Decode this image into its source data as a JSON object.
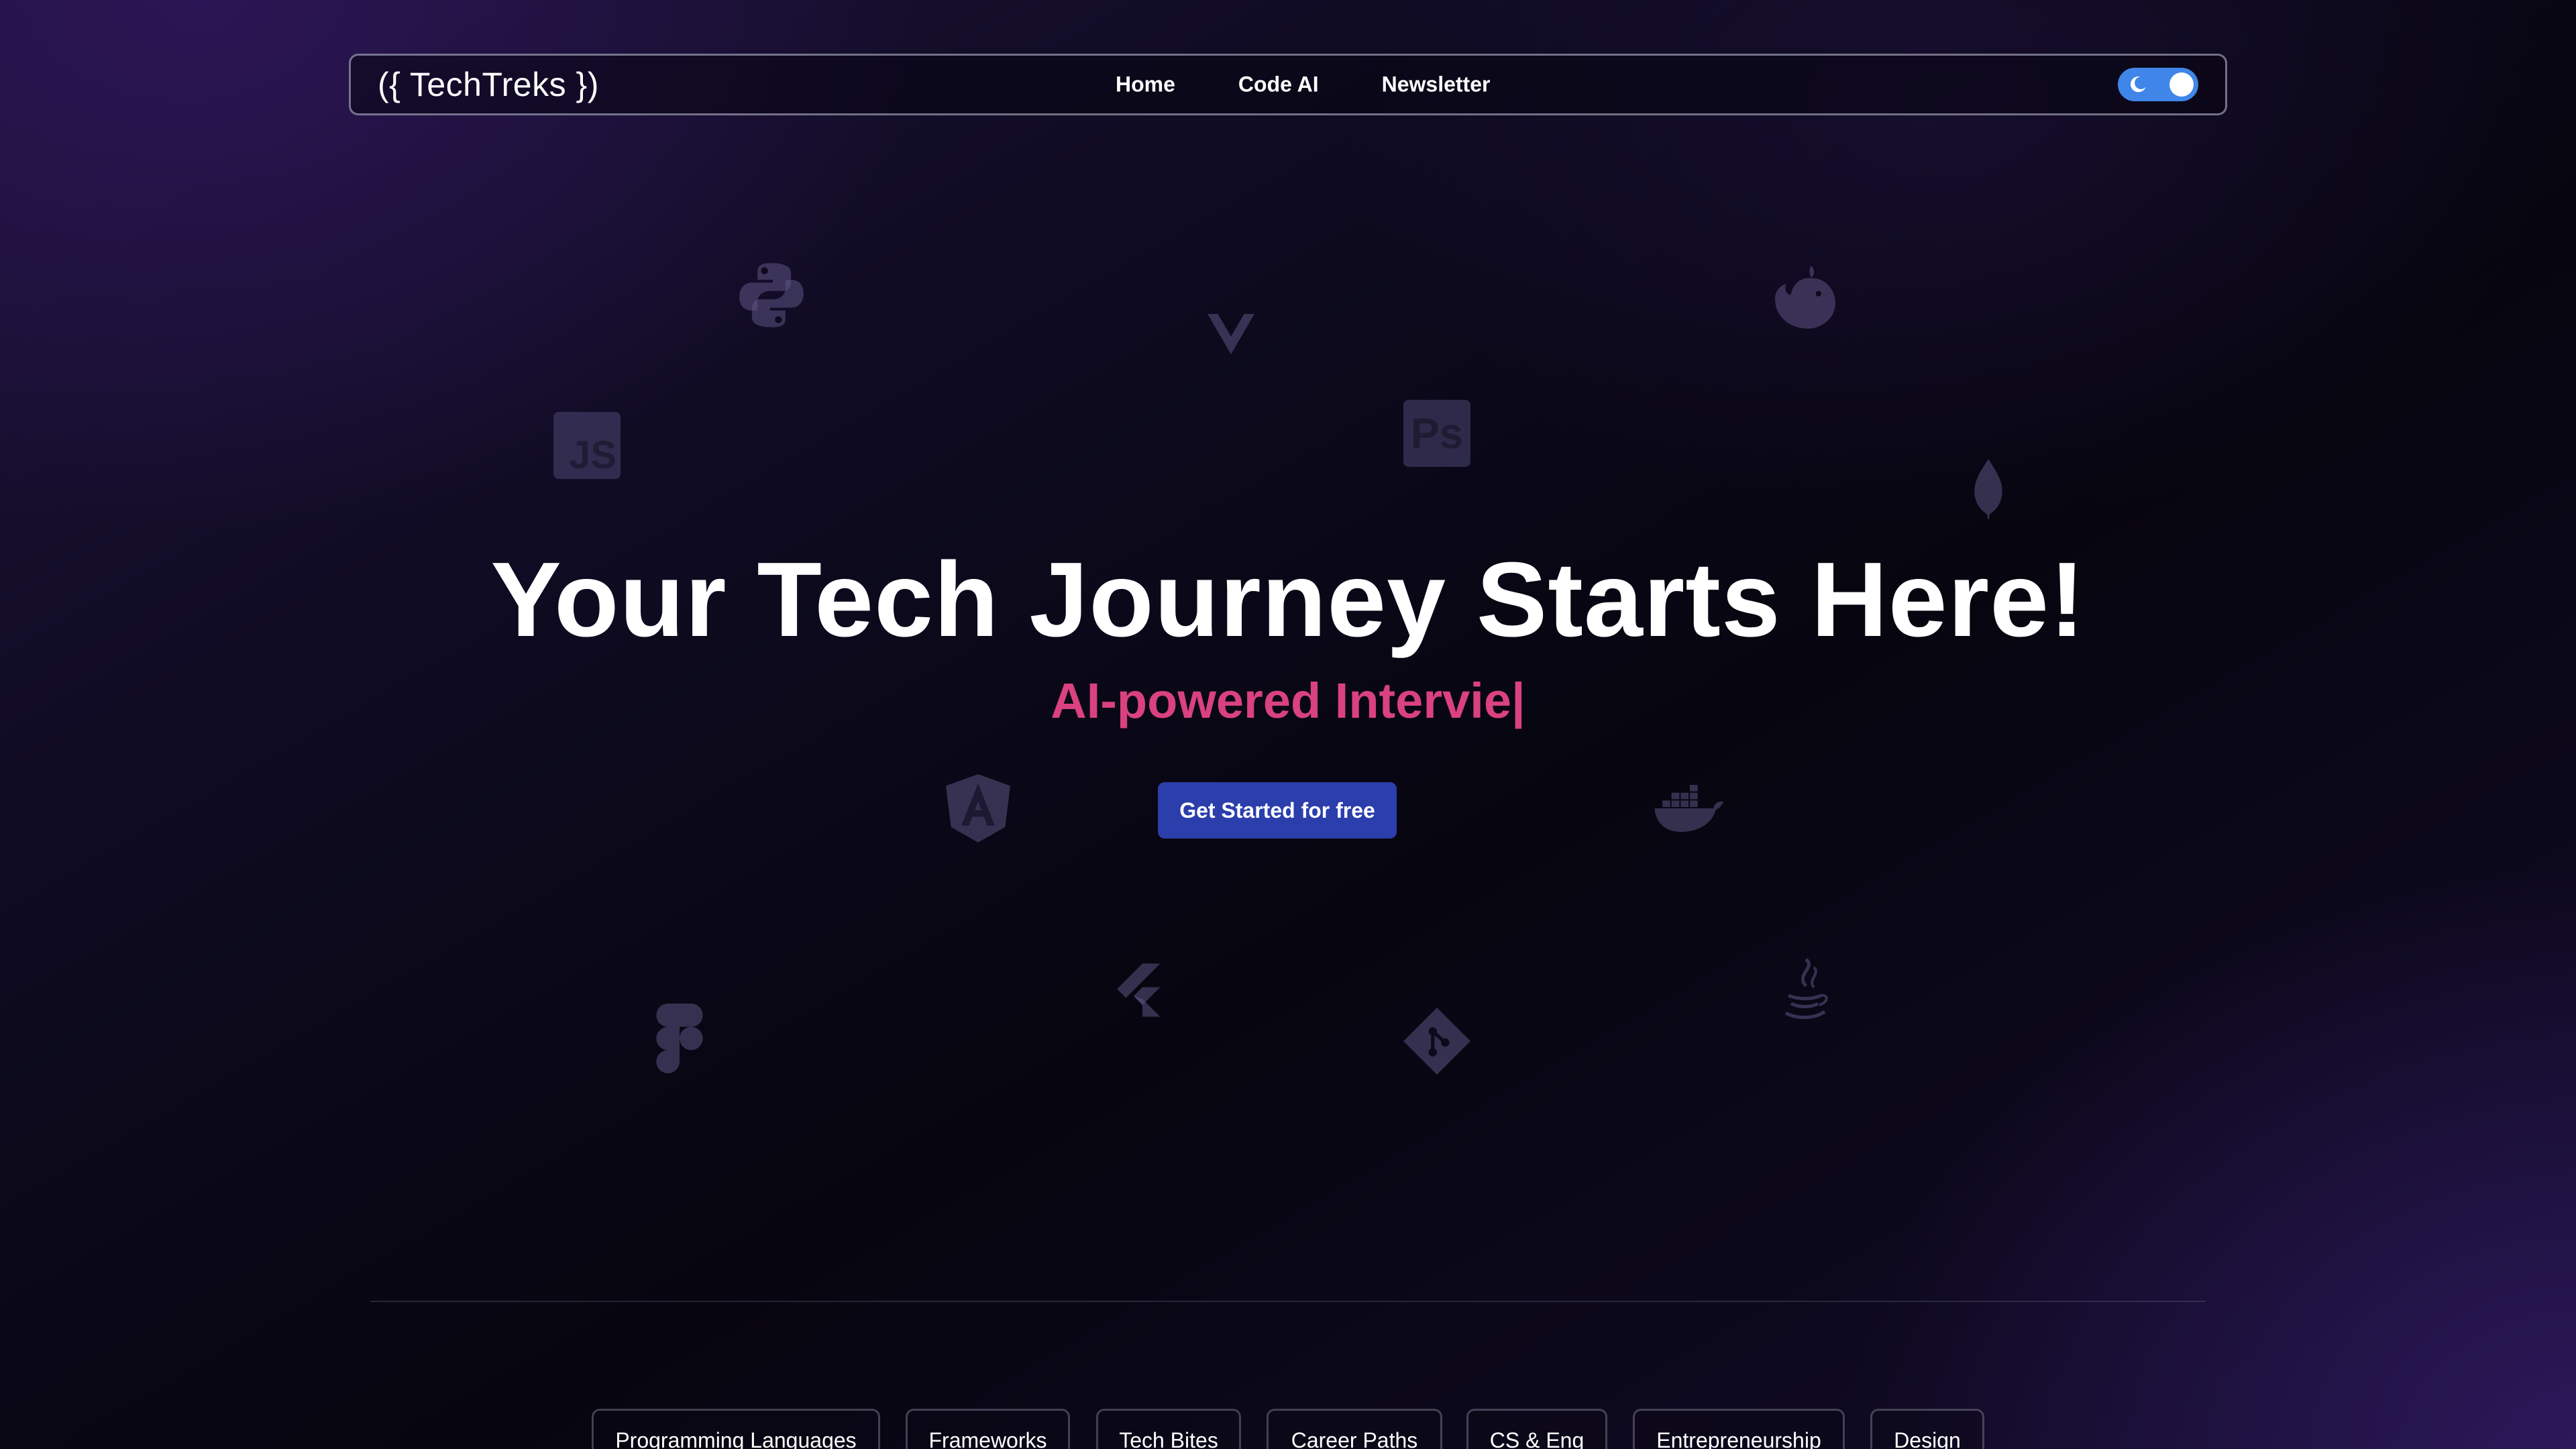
{
  "navbar": {
    "logo": "({ TechTreks })",
    "links": [
      {
        "label": "Home"
      },
      {
        "label": "Code AI"
      },
      {
        "label": "Newsletter"
      }
    ],
    "theme_toggle": {
      "state": "dark",
      "on": true
    }
  },
  "background_icons": [
    {
      "name": "python-icon"
    },
    {
      "name": "vue-icon"
    },
    {
      "name": "nestjs-icon"
    },
    {
      "name": "javascript-icon",
      "text": "JS"
    },
    {
      "name": "photoshop-icon",
      "text": "Ps"
    },
    {
      "name": "mongodb-icon"
    },
    {
      "name": "angular-icon"
    },
    {
      "name": "docker-icon"
    },
    {
      "name": "figma-icon"
    },
    {
      "name": "flutter-icon"
    },
    {
      "name": "git-icon"
    },
    {
      "name": "java-icon"
    }
  ],
  "hero": {
    "title": "Your Tech Journey Starts Here!",
    "subtitle": "AI-powered Intervie|",
    "cta_label": "Get Started for free"
  },
  "categories": [
    {
      "label": "Programming Languages"
    },
    {
      "label": "Frameworks"
    },
    {
      "label": "Tech Bites"
    },
    {
      "label": "Career Paths"
    },
    {
      "label": "CS & Eng"
    },
    {
      "label": "Entrepreneurship"
    },
    {
      "label": "Design"
    }
  ],
  "colors": {
    "accent_pink": "#d9427e",
    "cta_blue": "#2b3eab",
    "toggle_blue": "#3f86e8",
    "bg_dark": "#0d0a1e"
  }
}
